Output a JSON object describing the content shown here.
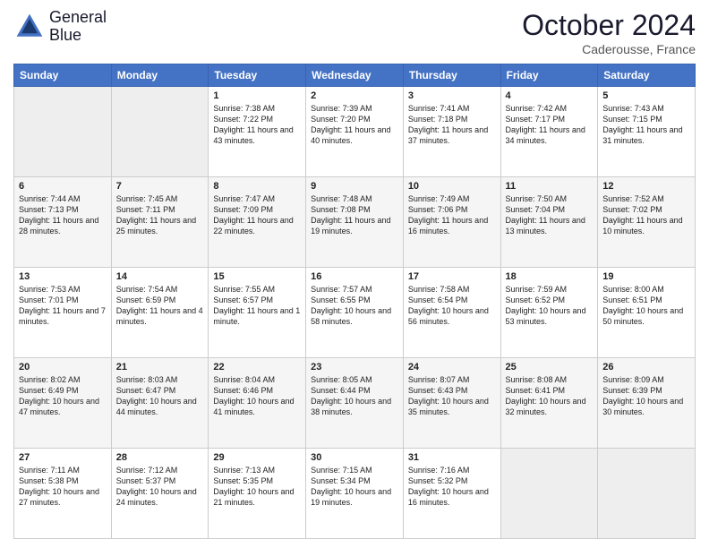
{
  "header": {
    "logo_line1": "General",
    "logo_line2": "Blue",
    "month": "October 2024",
    "location": "Caderousse, France"
  },
  "weekdays": [
    "Sunday",
    "Monday",
    "Tuesday",
    "Wednesday",
    "Thursday",
    "Friday",
    "Saturday"
  ],
  "weeks": [
    [
      {
        "day": "",
        "info": ""
      },
      {
        "day": "",
        "info": ""
      },
      {
        "day": "1",
        "info": "Sunrise: 7:38 AM\nSunset: 7:22 PM\nDaylight: 11 hours and 43 minutes."
      },
      {
        "day": "2",
        "info": "Sunrise: 7:39 AM\nSunset: 7:20 PM\nDaylight: 11 hours and 40 minutes."
      },
      {
        "day": "3",
        "info": "Sunrise: 7:41 AM\nSunset: 7:18 PM\nDaylight: 11 hours and 37 minutes."
      },
      {
        "day": "4",
        "info": "Sunrise: 7:42 AM\nSunset: 7:17 PM\nDaylight: 11 hours and 34 minutes."
      },
      {
        "day": "5",
        "info": "Sunrise: 7:43 AM\nSunset: 7:15 PM\nDaylight: 11 hours and 31 minutes."
      }
    ],
    [
      {
        "day": "6",
        "info": "Sunrise: 7:44 AM\nSunset: 7:13 PM\nDaylight: 11 hours and 28 minutes."
      },
      {
        "day": "7",
        "info": "Sunrise: 7:45 AM\nSunset: 7:11 PM\nDaylight: 11 hours and 25 minutes."
      },
      {
        "day": "8",
        "info": "Sunrise: 7:47 AM\nSunset: 7:09 PM\nDaylight: 11 hours and 22 minutes."
      },
      {
        "day": "9",
        "info": "Sunrise: 7:48 AM\nSunset: 7:08 PM\nDaylight: 11 hours and 19 minutes."
      },
      {
        "day": "10",
        "info": "Sunrise: 7:49 AM\nSunset: 7:06 PM\nDaylight: 11 hours and 16 minutes."
      },
      {
        "day": "11",
        "info": "Sunrise: 7:50 AM\nSunset: 7:04 PM\nDaylight: 11 hours and 13 minutes."
      },
      {
        "day": "12",
        "info": "Sunrise: 7:52 AM\nSunset: 7:02 PM\nDaylight: 11 hours and 10 minutes."
      }
    ],
    [
      {
        "day": "13",
        "info": "Sunrise: 7:53 AM\nSunset: 7:01 PM\nDaylight: 11 hours and 7 minutes."
      },
      {
        "day": "14",
        "info": "Sunrise: 7:54 AM\nSunset: 6:59 PM\nDaylight: 11 hours and 4 minutes."
      },
      {
        "day": "15",
        "info": "Sunrise: 7:55 AM\nSunset: 6:57 PM\nDaylight: 11 hours and 1 minute."
      },
      {
        "day": "16",
        "info": "Sunrise: 7:57 AM\nSunset: 6:55 PM\nDaylight: 10 hours and 58 minutes."
      },
      {
        "day": "17",
        "info": "Sunrise: 7:58 AM\nSunset: 6:54 PM\nDaylight: 10 hours and 56 minutes."
      },
      {
        "day": "18",
        "info": "Sunrise: 7:59 AM\nSunset: 6:52 PM\nDaylight: 10 hours and 53 minutes."
      },
      {
        "day": "19",
        "info": "Sunrise: 8:00 AM\nSunset: 6:51 PM\nDaylight: 10 hours and 50 minutes."
      }
    ],
    [
      {
        "day": "20",
        "info": "Sunrise: 8:02 AM\nSunset: 6:49 PM\nDaylight: 10 hours and 47 minutes."
      },
      {
        "day": "21",
        "info": "Sunrise: 8:03 AM\nSunset: 6:47 PM\nDaylight: 10 hours and 44 minutes."
      },
      {
        "day": "22",
        "info": "Sunrise: 8:04 AM\nSunset: 6:46 PM\nDaylight: 10 hours and 41 minutes."
      },
      {
        "day": "23",
        "info": "Sunrise: 8:05 AM\nSunset: 6:44 PM\nDaylight: 10 hours and 38 minutes."
      },
      {
        "day": "24",
        "info": "Sunrise: 8:07 AM\nSunset: 6:43 PM\nDaylight: 10 hours and 35 minutes."
      },
      {
        "day": "25",
        "info": "Sunrise: 8:08 AM\nSunset: 6:41 PM\nDaylight: 10 hours and 32 minutes."
      },
      {
        "day": "26",
        "info": "Sunrise: 8:09 AM\nSunset: 6:39 PM\nDaylight: 10 hours and 30 minutes."
      }
    ],
    [
      {
        "day": "27",
        "info": "Sunrise: 7:11 AM\nSunset: 5:38 PM\nDaylight: 10 hours and 27 minutes."
      },
      {
        "day": "28",
        "info": "Sunrise: 7:12 AM\nSunset: 5:37 PM\nDaylight: 10 hours and 24 minutes."
      },
      {
        "day": "29",
        "info": "Sunrise: 7:13 AM\nSunset: 5:35 PM\nDaylight: 10 hours and 21 minutes."
      },
      {
        "day": "30",
        "info": "Sunrise: 7:15 AM\nSunset: 5:34 PM\nDaylight: 10 hours and 19 minutes."
      },
      {
        "day": "31",
        "info": "Sunrise: 7:16 AM\nSunset: 5:32 PM\nDaylight: 10 hours and 16 minutes."
      },
      {
        "day": "",
        "info": ""
      },
      {
        "day": "",
        "info": ""
      }
    ]
  ]
}
